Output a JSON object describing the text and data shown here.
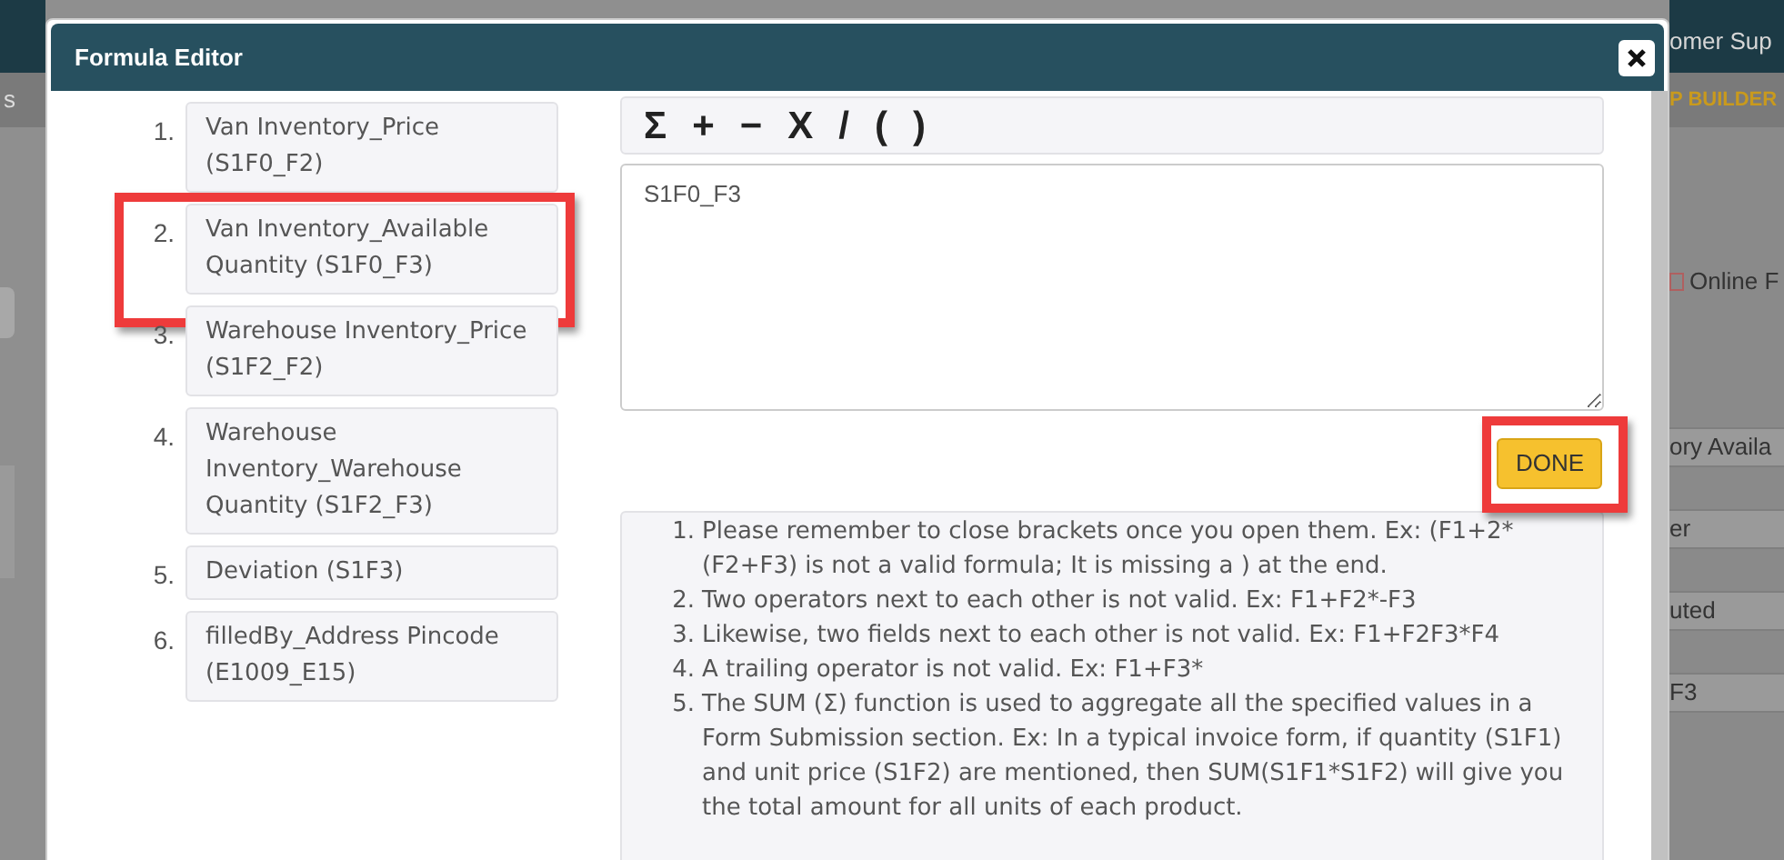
{
  "background": {
    "header_text": "omer Sup",
    "builder_text": "P BUILDER",
    "left_tab": "s",
    "checkbox": {
      "label": "Online F",
      "checked": false
    },
    "fields": [
      "ory Availa",
      "er",
      "uted",
      "F3"
    ]
  },
  "dialog": {
    "title": "Formula Editor",
    "fields": [
      {
        "number": "1.",
        "label": "Van Inventory_Price (S1F0_F2)",
        "highlighted": false
      },
      {
        "number": "2.",
        "label": "Van Inventory_Available Quantity (S1F0_F3)",
        "highlighted": true
      },
      {
        "number": "3.",
        "label": "Warehouse Inventory_Price (S1F2_F2)",
        "highlighted": false
      },
      {
        "number": "4.",
        "label": "Warehouse Inventory_Warehouse Quantity (S1F2_F3)",
        "highlighted": false
      },
      {
        "number": "5.",
        "label": "Deviation (S1F3)",
        "highlighted": false
      },
      {
        "number": "6.",
        "label": "filledBy_Address Pincode (E1009_E15)",
        "highlighted": false
      }
    ],
    "operators": [
      "Σ",
      "+",
      "−",
      "X",
      "/",
      "(",
      ")"
    ],
    "formula": "S1F0_F3",
    "done": {
      "label": "DONE",
      "highlighted": true
    },
    "notes": [
      {
        "number": "1.",
        "text": "Please remember to close brackets once you open them. Ex: (F1+2*(F2+F3) is not a valid formula; It is missing a ) at the end."
      },
      {
        "number": "2.",
        "text": "Two operators next to each other is not valid. Ex: F1+F2*-F3"
      },
      {
        "number": "3.",
        "text": "Likewise, two fields next to each other is not valid. Ex: F1+F2F3*F4"
      },
      {
        "number": "4.",
        "text": "A trailing operator is not valid. Ex: F1+F3*"
      },
      {
        "number": "5.",
        "text": "The SUM (Σ) function is used to aggregate all the specified values in a Form Submission section. Ex: In a typical invoice form, if quantity (S1F1) and unit price (S1F2) are mentioned, then SUM(S1F1*S1F2) will give you the total amount for all units of each product."
      }
    ]
  }
}
